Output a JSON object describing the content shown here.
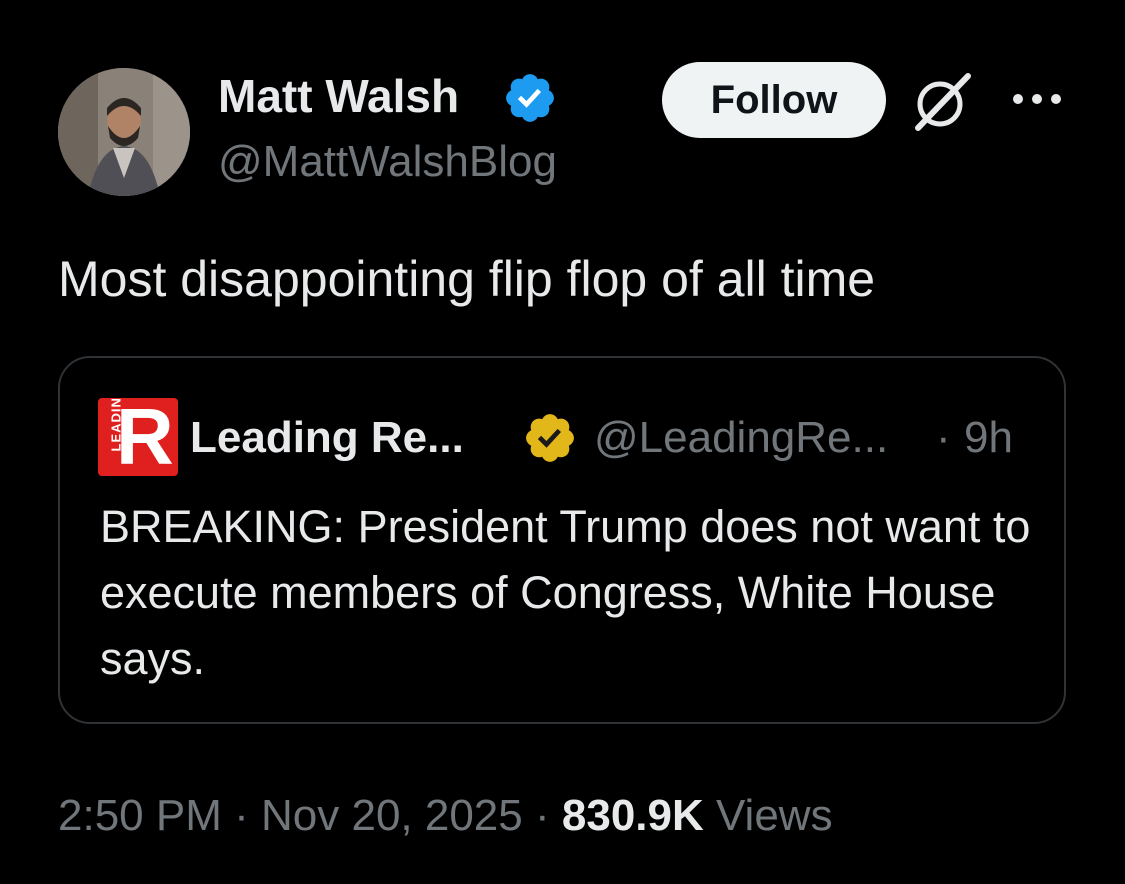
{
  "author": {
    "name": "Matt Walsh",
    "handle": "@MattWalshBlog",
    "verified_color": "#1d9bf0"
  },
  "actions": {
    "follow_label": "Follow"
  },
  "tweet": {
    "text": "Most disappointing flip flop of all time"
  },
  "quote": {
    "logo_letter": "R",
    "logo_vertical_text": "LEADING",
    "name": "Leading Re...",
    "handle": "@LeadingRe...",
    "separator": "·",
    "time": "9h",
    "text": "BREAKING: President Trump does not want to execute members of Congress, White House says.",
    "verified_color": "#e2b719",
    "logo_color": "#e0201e"
  },
  "meta": {
    "time": "2:50 PM",
    "sep1": "·",
    "date": "Nov 20, 2025",
    "sep2": "·",
    "views_count": "830.9K",
    "views_label": "Views"
  },
  "icons": {
    "verified": "verified-badge-icon",
    "grok": "grok-icon",
    "more": "more-dots-icon"
  }
}
